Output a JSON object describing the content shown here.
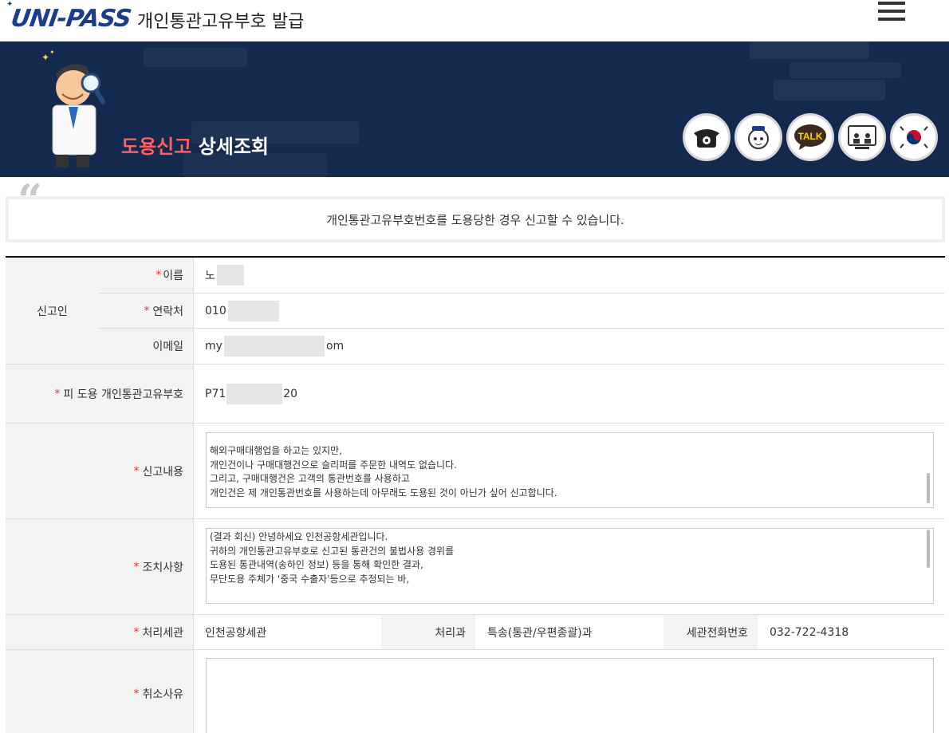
{
  "header": {
    "logo_text": "UNI-PASS",
    "site_title": "개인통관고유부호 발급",
    "menu_icon": "hamburger-icon"
  },
  "banner": {
    "heading_highlight": "도용신고",
    "heading_rest": "상세조회",
    "quick_icons": [
      "phone-icon",
      "chatbot-icon",
      "kakao-talk-icon",
      "remote-support-icon",
      "government-emblem-icon"
    ],
    "talk_label": "TALK"
  },
  "notice": {
    "text": "개인통관고유부호번호를 도용당한 경우 신고할 수 있습니다."
  },
  "colors": {
    "banner_bg": "#13294e",
    "heading_highlight": "#ff5f5f",
    "required_mark": "#e8312f"
  },
  "form": {
    "required_mark": "*",
    "reporter_group_label": "신고인",
    "name": {
      "label": "이름",
      "value_visible": "노"
    },
    "contact": {
      "label": "연락처",
      "value_visible": "010"
    },
    "email": {
      "label": "이메일",
      "value_start": "my",
      "value_end": "om"
    },
    "victim_code": {
      "label": "피 도용 개인통관고유부호",
      "value_start": "P71",
      "value_end": "20"
    },
    "report_content": {
      "label": "신고내용",
      "text": "해외구매대행업을 하고는 있지만,\n개인건이나 구매대행건으로 슬리퍼를 주문한 내역도 없습니다.\n그리고, 구매대행건은 고객의 통관번호를 사용하고\n개인건은 제 개인통관번호를 사용하는데 아무래도 도용된 것이 아닌가 싶어 신고합니다."
    },
    "action": {
      "label": "조치사항",
      "text": "(결과 회신) 안녕하세요 인천공항세관입니다.\n귀하의 개인통관고유부호로 신고된 통관건의 불법사용 경위를\n도용된 통관내역(송하인 정보) 등을 통해 확인한 결과,\n무단도용 주체가 '중국 수출자'등으로 추정되는 바,"
    },
    "customs_office": {
      "label": "처리세관",
      "value": "인천공항세관"
    },
    "department": {
      "label": "처리과",
      "value": "특송(통관/우편종괄)과"
    },
    "phone": {
      "label": "세관전화번호",
      "value": "032-722-4318"
    },
    "cancel_reason": {
      "label": "취소사유",
      "text": ""
    }
  }
}
